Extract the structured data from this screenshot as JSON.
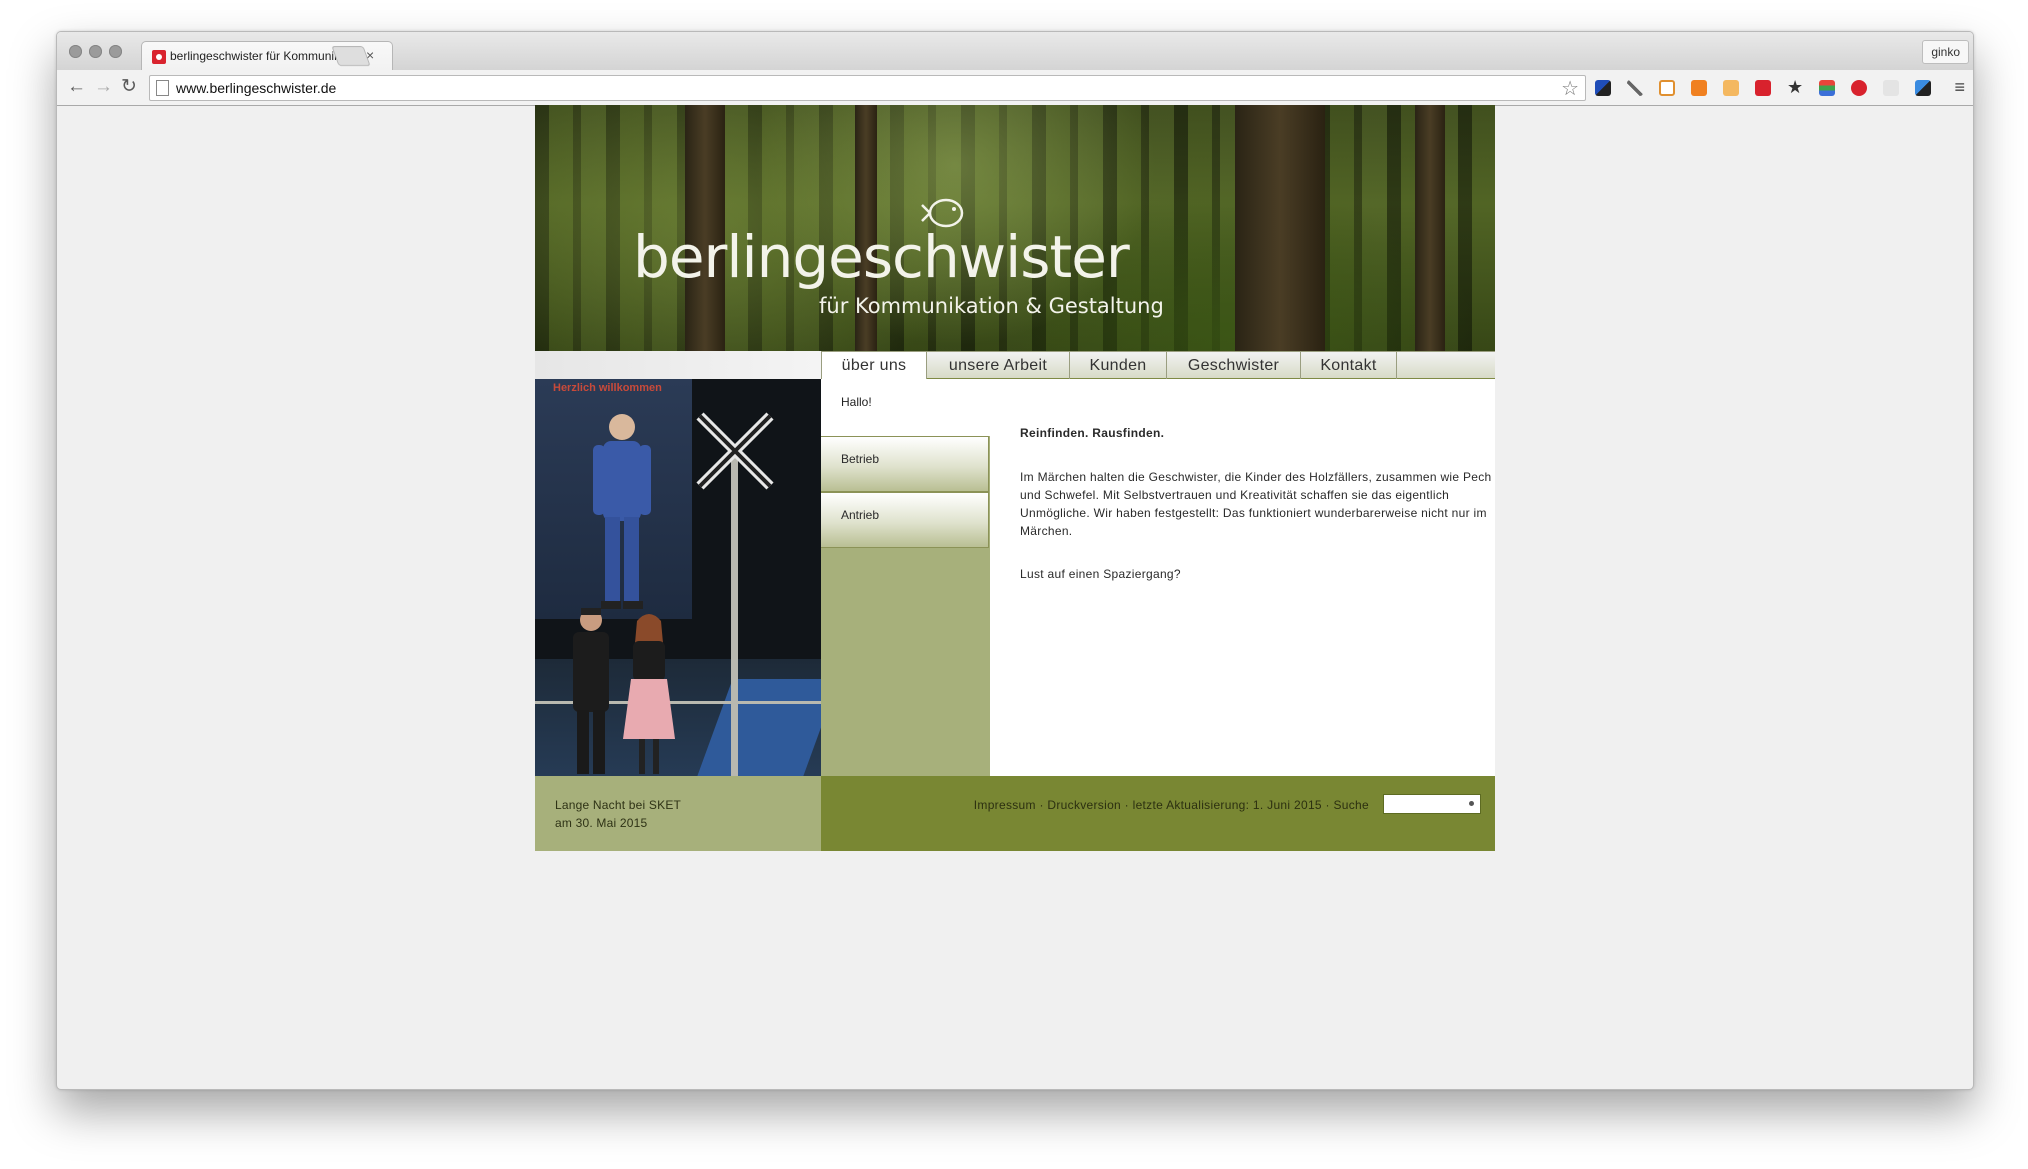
{
  "browser": {
    "tab_title": "berlingeschwister für Kommunikation & Gestaltung",
    "tab_close": "×",
    "profile_name": "ginko",
    "url": "www.berlingeschwister.de",
    "back_glyph": "←",
    "forward_glyph": "→",
    "reload_glyph": "↻",
    "menu_glyph": "≡",
    "star_glyph": "☆",
    "extensions": [
      "delicious-icon",
      "eyedropper-icon",
      "bookmark-icon",
      "chart-icon",
      "plug-icon",
      "calendar-icon",
      "star-icon",
      "colorzilla-icon",
      "adblock-icon",
      "ok-icon",
      "delicious-alt-icon"
    ]
  },
  "site": {
    "logo": "berlingeschwister",
    "tagline": "für Kommunikation & Gestaltung",
    "nav": [
      "über uns",
      "unsere Arbeit",
      "Kunden",
      "Geschwister",
      "Kontakt"
    ],
    "active_nav": "über uns",
    "photo_banner_text": "Herzlich willkommen",
    "subnav": {
      "hallo": "Hallo!",
      "items": [
        "Betrieb",
        "Antrieb"
      ]
    },
    "content": {
      "title": "Reinfinden. Rausfinden.",
      "paragraph": "Im Märchen halten die Geschwister, die Kinder des Holzfällers, zusammen wie Pech und Schwefel. Mit Selbstvertrauen und Kreativität schaffen sie das eigentlich Unmögliche. Wir haben festgestellt: Das funktioniert wunderbarerweise nicht nur im Märchen.",
      "question": "Lust auf einen Spaziergang?"
    },
    "footer": {
      "caption_line1": "Lange Nacht bei SKET",
      "caption_line2": "am 30. Mai 2015",
      "impressum": "Impressum",
      "druckversion": "Druckversion",
      "aktualisierung": "letzte Aktualisierung: 1. Juni 2015",
      "suche": "Suche",
      "separator": "·"
    }
  },
  "colors": {
    "olive_dark": "#798733",
    "olive_light": "#a7b07b",
    "window_bg": "#f0f0f0"
  }
}
